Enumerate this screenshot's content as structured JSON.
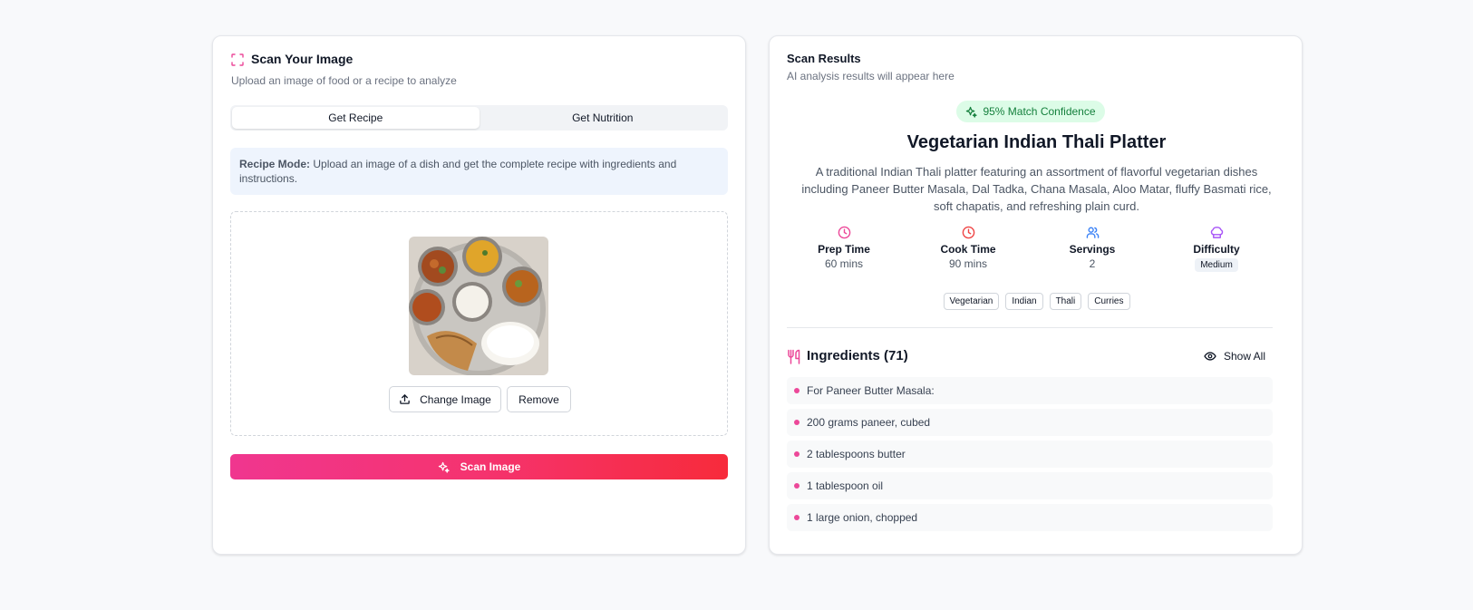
{
  "colors": {
    "accent": "#ec4899",
    "scan_gradient_start": "#f0368f",
    "scan_gradient_end": "#f72b3b",
    "confidence_bg": "#dcfce7",
    "confidence_text": "#15803d"
  },
  "scanner": {
    "title": "Scan Your Image",
    "subtitle": "Upload an image of food or a recipe to analyze",
    "tabs": [
      {
        "label": "Get Recipe",
        "active": true
      },
      {
        "label": "Get Nutrition",
        "active": false
      }
    ],
    "mode_label": "Recipe Mode:",
    "mode_text": " Upload an image of a dish and get the complete recipe with ingredients and instructions.",
    "change_image_label": "Change Image",
    "remove_label": "Remove",
    "scan_button_label": "Scan Image"
  },
  "results": {
    "title": "Scan Results",
    "subtitle": "AI analysis results will appear here",
    "confidence": "95% Match Confidence",
    "dish_name": "Vegetarian Indian Thali Platter",
    "description": "A traditional Indian Thali platter featuring an assortment of flavorful vegetarian dishes including Paneer Butter Masala, Dal Tadka, Chana Masala, Aloo Matar, fluffy Basmati rice, soft chapatis, and refreshing plain curd.",
    "stats": {
      "prep": {
        "label": "Prep Time",
        "value": "60 mins",
        "icon": "clock-icon"
      },
      "cook": {
        "label": "Cook Time",
        "value": "90 mins",
        "icon": "clock-icon"
      },
      "servings": {
        "label": "Servings",
        "value": "2",
        "icon": "users-icon"
      },
      "difficulty": {
        "label": "Difficulty",
        "value": "Medium",
        "icon": "chef-hat-icon"
      }
    },
    "tags": [
      "Vegetarian",
      "Indian",
      "Thali",
      "Curries"
    ],
    "ingredients_title": "Ingredients (71)",
    "show_all_label": "Show All",
    "ingredients": [
      "For Paneer Butter Masala:",
      "200 grams paneer, cubed",
      "2 tablespoons butter",
      "1 tablespoon oil",
      "1 large onion, chopped"
    ]
  }
}
